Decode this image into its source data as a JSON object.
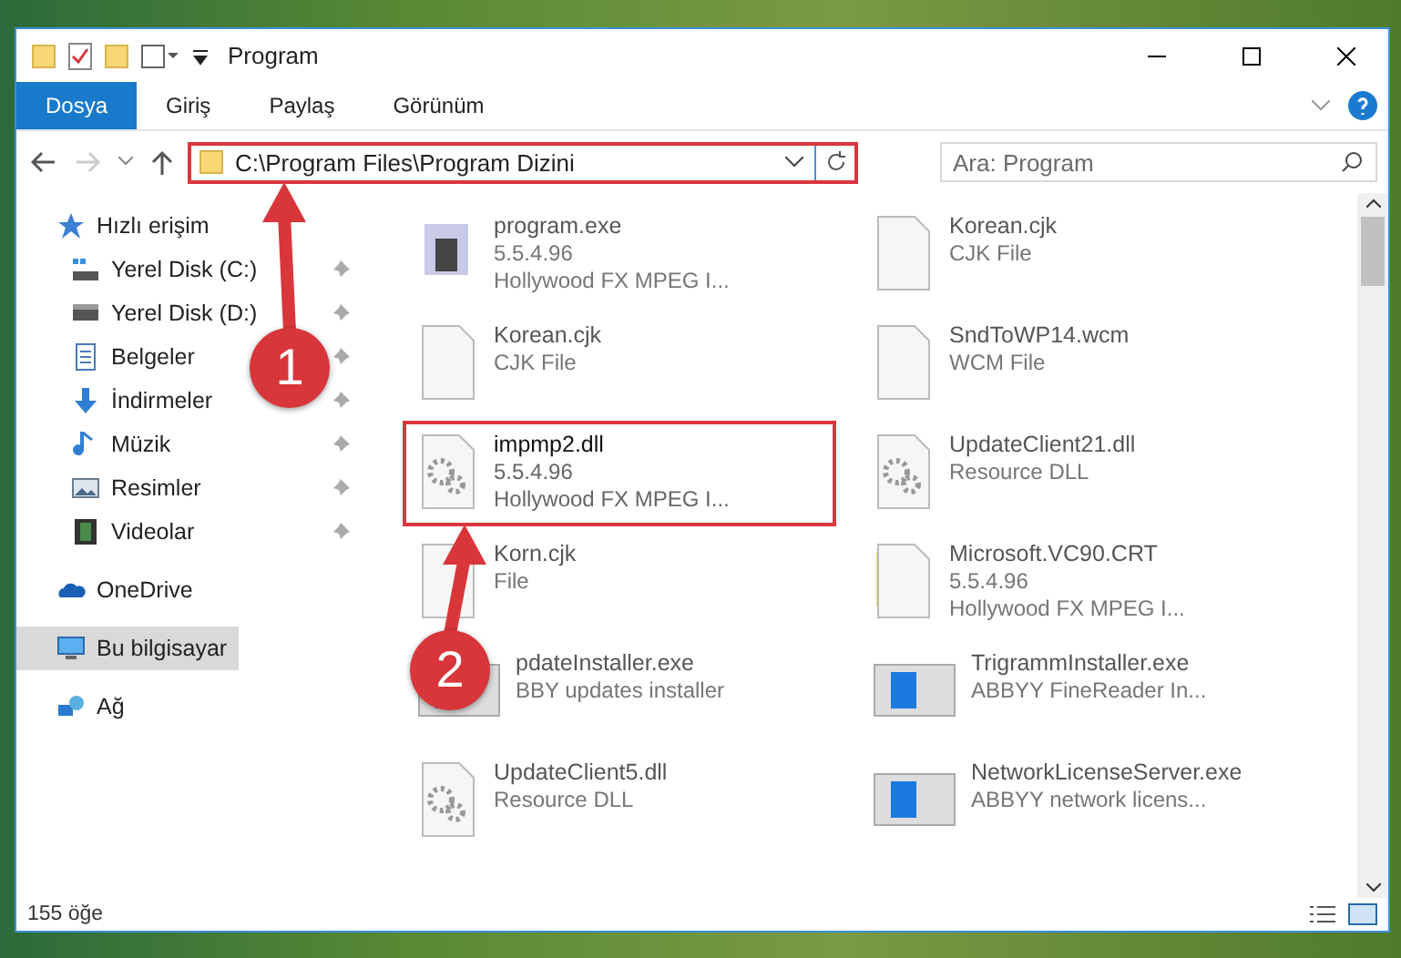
{
  "window": {
    "title": "Program"
  },
  "ribbon": {
    "tabs": [
      {
        "label": "Dosya",
        "selected": true
      },
      {
        "label": "Giriş",
        "selected": false
      },
      {
        "label": "Paylaş",
        "selected": false
      },
      {
        "label": "Görünüm",
        "selected": false
      }
    ]
  },
  "address": {
    "path": "C:\\Program Files\\Program Dizini",
    "highlighted": true
  },
  "search": {
    "placeholder": "Ara: Program"
  },
  "sidebar": {
    "items": [
      {
        "label": "Hızlı erişim",
        "kind": "star",
        "selected": false,
        "children": [
          {
            "label": "Yerel Disk (C:)",
            "kind": "drive-c",
            "selected": false,
            "pinned": true
          },
          {
            "label": "Yerel Disk (D:)",
            "kind": "drive",
            "selected": false,
            "pinned": true
          },
          {
            "label": "Belgeler",
            "kind": "document",
            "selected": false,
            "pinned": true
          },
          {
            "label": "İndirmeler",
            "kind": "download",
            "selected": false,
            "pinned": true
          },
          {
            "label": "Müzik",
            "kind": "music",
            "selected": false,
            "pinned": true
          },
          {
            "label": "Resimler",
            "kind": "image",
            "selected": false,
            "pinned": true
          },
          {
            "label": "Videolar",
            "kind": "video",
            "selected": false,
            "pinned": true
          }
        ]
      },
      {
        "label": "OneDrive",
        "kind": "cloud",
        "selected": false
      },
      {
        "label": "Bu bilgisayar",
        "kind": "computer",
        "selected": true
      },
      {
        "label": "Ağ",
        "kind": "network",
        "selected": false
      }
    ]
  },
  "files": [
    {
      "name": "program.exe",
      "details": [
        "5.5.4.96",
        "Hollywood FX MPEG I..."
      ],
      "kind": "app",
      "dimmed": true,
      "highlighted": false
    },
    {
      "name": "Korean.cjk",
      "details": [
        "CJK File"
      ],
      "kind": "blank",
      "dimmed": true,
      "highlighted": false
    },
    {
      "name": "Korean.cjk",
      "details": [
        "CJK File"
      ],
      "kind": "blank",
      "dimmed": true,
      "highlighted": false
    },
    {
      "name": "SndToWP14.wcm",
      "details": [
        "WCM File"
      ],
      "kind": "blank",
      "dimmed": true,
      "highlighted": false
    },
    {
      "name": "impmp2.dll",
      "details": [
        "5.5.4.96",
        "Hollywood FX MPEG I..."
      ],
      "kind": "dll",
      "dimmed": false,
      "highlighted": true
    },
    {
      "name": "UpdateClient21.dll",
      "details": [
        "Resource DLL"
      ],
      "kind": "dll",
      "dimmed": true,
      "highlighted": false
    },
    {
      "name": "Korn.cjk",
      "details": [
        "File"
      ],
      "kind": "blank",
      "dimmed": true,
      "highlighted": false
    },
    {
      "name": "Microsoft.VC90.CRT",
      "details": [
        "5.5.4.96",
        "Hollywood FX MPEG I..."
      ],
      "kind": "folder",
      "dimmed": true,
      "highlighted": false
    },
    {
      "name": "pdateInstaller.exe",
      "details": [
        "BBY updates installer"
      ],
      "kind": "installer",
      "dimmed": true,
      "highlighted": false
    },
    {
      "name": "TrigrammInstaller.exe",
      "details": [
        "ABBYY FineReader In..."
      ],
      "kind": "installer",
      "dimmed": true,
      "highlighted": false
    },
    {
      "name": "UpdateClient5.dll",
      "details": [
        "Resource DLL"
      ],
      "kind": "dll",
      "dimmed": true,
      "highlighted": false
    },
    {
      "name": "NetworkLicenseServer.exe",
      "details": [
        "ABBYY network licens..."
      ],
      "kind": "installer",
      "dimmed": true,
      "highlighted": false
    }
  ],
  "annotations": [
    {
      "label": "1"
    },
    {
      "label": "2"
    }
  ],
  "status_bar": {
    "count": "155 öğe"
  }
}
